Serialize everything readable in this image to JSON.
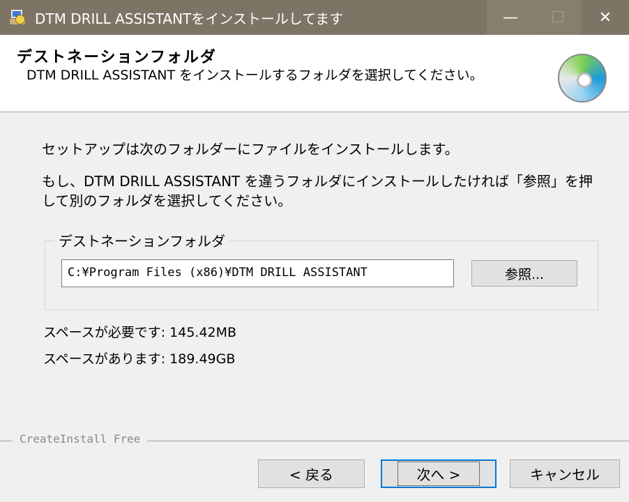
{
  "window": {
    "title": "DTM DRILL ASSISTANTをインストールしてます",
    "minimize": "—",
    "maximize": "☐",
    "close": "✕"
  },
  "header": {
    "title": "デストネーションフォルダ",
    "description": "DTM DRILL ASSISTANT をインストールするフォルダを選択してください。"
  },
  "body": {
    "line1": "セットアップは次のフォルダーにファイルをインストールします。",
    "line2": "もし、DTM DRILL ASSISTANT を違うフォルダにインストールしたければ「参照」を押して別のフォルダを選択してください。"
  },
  "destination": {
    "group_label": "デストネーションフォルダ",
    "path": "C:¥Program Files (x86)¥DTM DRILL ASSISTANT",
    "browse_label": "参照..."
  },
  "space": {
    "required": "スペースが必要です: 145.42MB",
    "available": "スペースがあります: 189.49GB"
  },
  "footer": {
    "brand": "CreateInstall Free",
    "back_label": "< 戻る",
    "next_label": "次へ >",
    "cancel_label": "キャンセル"
  }
}
